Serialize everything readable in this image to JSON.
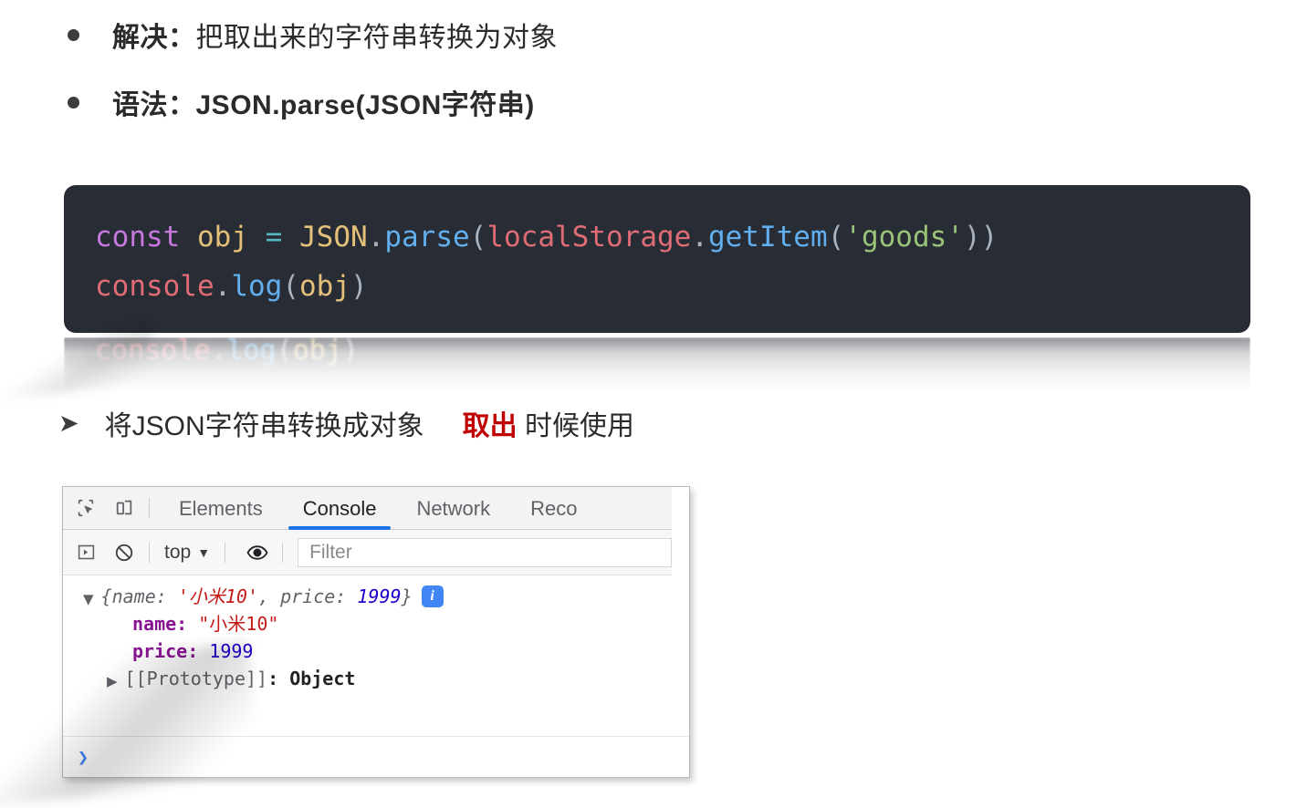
{
  "slide": {
    "bullets": [
      {
        "icon": "bullet-dot",
        "label": "解决：",
        "body": "把取出来的字符串转换为对象"
      },
      {
        "icon": "bullet-dot",
        "label": "语法：",
        "body": "JSON.parse(JSON字符串)"
      }
    ],
    "arrow_line": {
      "icon": "arrow-bullet-icon",
      "text_before": "将JSON字符串转换成对象",
      "highlight": "取出",
      "highlight_color": "#c00000",
      "text_after": "时候使用"
    }
  },
  "code_block": {
    "background": "#282c34",
    "lines": [
      [
        {
          "t": "const",
          "c": "kw"
        },
        {
          "t": " ",
          "c": "plain"
        },
        {
          "t": "obj",
          "c": "var"
        },
        {
          "t": " ",
          "c": "plain"
        },
        {
          "t": "=",
          "c": "op"
        },
        {
          "t": " ",
          "c": "plain"
        },
        {
          "t": "JSON",
          "c": "obj"
        },
        {
          "t": ".",
          "c": "punc"
        },
        {
          "t": "parse",
          "c": "fn"
        },
        {
          "t": "(",
          "c": "punc"
        },
        {
          "t": "localStorage",
          "c": "id"
        },
        {
          "t": ".",
          "c": "punc"
        },
        {
          "t": "getItem",
          "c": "fn"
        },
        {
          "t": "(",
          "c": "punc"
        },
        {
          "t": "'goods'",
          "c": "str"
        },
        {
          "t": "))",
          "c": "punc"
        }
      ],
      [
        {
          "t": "console",
          "c": "id"
        },
        {
          "t": ".",
          "c": "punc"
        },
        {
          "t": "log",
          "c": "fn"
        },
        {
          "t": "(",
          "c": "punc"
        },
        {
          "t": "obj",
          "c": "var"
        },
        {
          "t": ")",
          "c": "punc"
        }
      ]
    ]
  },
  "code_ghost": {
    "note": "fading-out duplicate code block",
    "lines": [
      [
        {
          "t": "console",
          "c": "id"
        },
        {
          "t": ".",
          "c": "punc"
        },
        {
          "t": "log",
          "c": "fn"
        },
        {
          "t": "(",
          "c": "punc"
        },
        {
          "t": "obj",
          "c": "var"
        },
        {
          "t": ")",
          "c": "punc"
        }
      ]
    ]
  },
  "devtools": {
    "toolbar": {
      "inspect_icon": "inspect-element-icon",
      "device_icon": "device-toolbar-icon",
      "tabs": [
        {
          "label": "Elements",
          "active": false
        },
        {
          "label": "Console",
          "active": true
        },
        {
          "label": "Network",
          "active": false
        },
        {
          "label": "Reco",
          "active": false
        }
      ],
      "active_tab_color": "#1a73e8"
    },
    "filterbar": {
      "execute_icon": "execute-sidebar-icon",
      "clear_icon": "clear-console-icon",
      "context": "top",
      "context_caret": "▼",
      "eye_icon": "live-expression-eye-icon",
      "filter_placeholder": "Filter",
      "filter_value": ""
    },
    "console": {
      "rows": [
        {
          "triangle": "▼",
          "indent": 1,
          "segments": [
            {
              "t": "{name: ",
              "c": "grey-i"
            },
            {
              "t": "'小米10'",
              "c": "red-i"
            },
            {
              "t": ", price: ",
              "c": "grey-i"
            },
            {
              "t": "1999",
              "c": "blue-i"
            },
            {
              "t": "}",
              "c": "grey-i"
            }
          ],
          "badge": "i"
        },
        {
          "triangle": "",
          "indent": 2,
          "segments": [
            {
              "t": "name: ",
              "c": "purple"
            },
            {
              "t": "\"小米10\"",
              "c": "red"
            }
          ],
          "badge": ""
        },
        {
          "triangle": "",
          "indent": 2,
          "segments": [
            {
              "t": "price: ",
              "c": "purple"
            },
            {
              "t": "1999",
              "c": "blue"
            }
          ],
          "badge": ""
        },
        {
          "triangle": "▶",
          "indent": 1,
          "segments": [
            {
              "t": "[[Prototype]]",
              "c": "grey"
            },
            {
              "t": ": ",
              "c": "dark"
            },
            {
              "t": "Object",
              "c": "dark"
            }
          ],
          "badge": ""
        }
      ],
      "prompt_symbol": "❯",
      "prompt_value": ""
    }
  }
}
